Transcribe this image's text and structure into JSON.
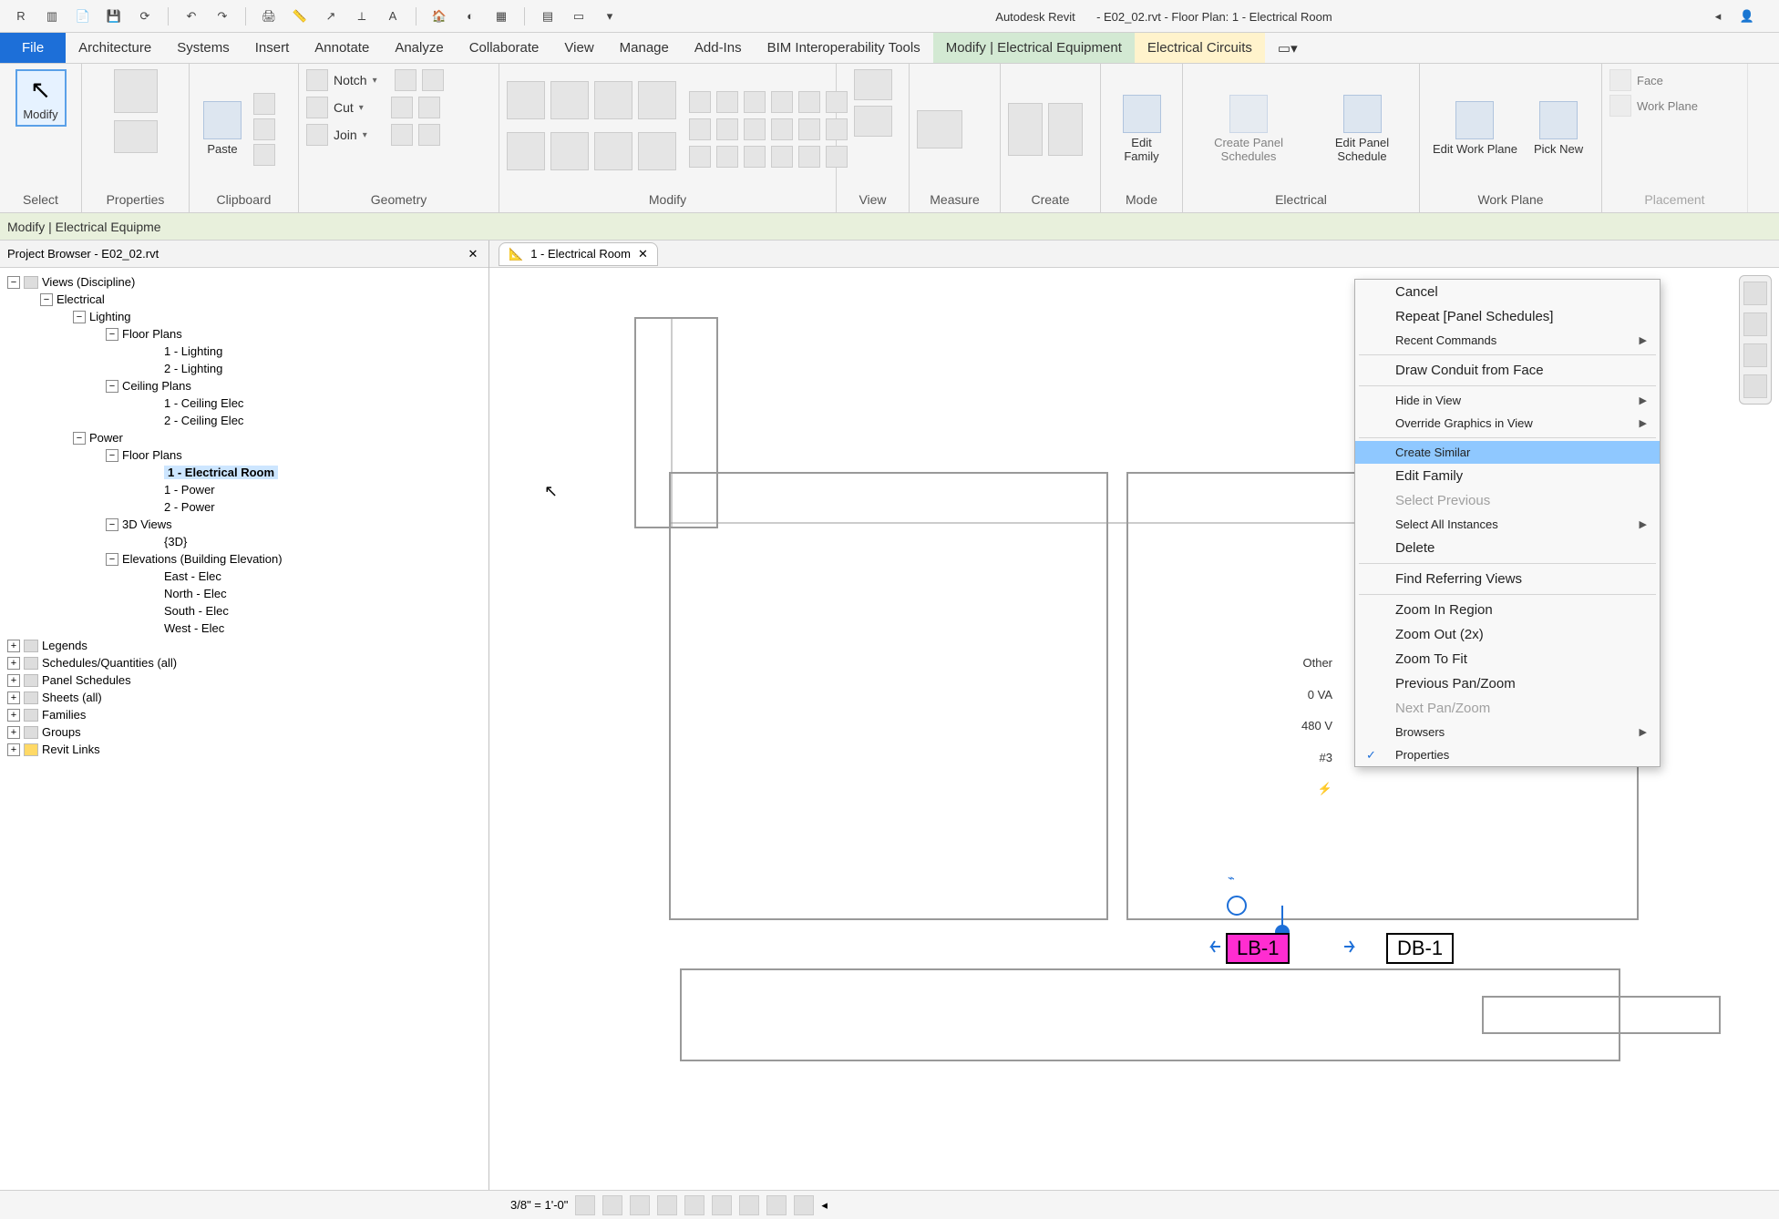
{
  "title": {
    "app": "Autodesk Revit",
    "doc": "- E02_02.rvt - Floor Plan: 1 - Electrical Room"
  },
  "menu": {
    "file": "File",
    "tabs": [
      "Architecture",
      "Systems",
      "Insert",
      "Annotate",
      "Analyze",
      "Collaborate",
      "View",
      "Manage",
      "Add-Ins",
      "BIM Interoperability Tools"
    ],
    "active": "Modify | Electrical Equipment",
    "second": "Electrical Circuits"
  },
  "ribbon": {
    "modify_label": "Modify",
    "select_group": "Select",
    "properties": "Properties",
    "clipboard": "Clipboard",
    "paste": "Paste",
    "geometry": "Geometry",
    "notch": "Notch",
    "cut": "Cut",
    "join": "Join",
    "modify": "Modify",
    "view": "View",
    "measure": "Measure",
    "create": "Create",
    "mode": "Mode",
    "edit_family": "Edit Family",
    "electrical": "Electrical",
    "create_ps": "Create Panel Schedules",
    "edit_ps": "Edit Panel Schedule",
    "work_plane_group": "Work Plane",
    "edit_wp": "Edit Work Plane",
    "pick_new": "Pick New",
    "placement": "Placement",
    "face": "Face",
    "wp": "Work Plane"
  },
  "context_bar": "Modify | Electrical Equipme",
  "project_browser": {
    "title": "Project Browser - E02_02.rvt",
    "views_root": "Views (Discipline)",
    "nodes": {
      "electrical": "Electrical",
      "lighting": "Lighting",
      "floor_plans": "Floor Plans",
      "lighting_1": "1 - Lighting",
      "lighting_2": "2 - Lighting",
      "ceiling_plans": "Ceiling Plans",
      "ceiling_1": "1 - Ceiling Elec",
      "ceiling_2": "2 - Ceiling Elec",
      "power": "Power",
      "power_fp": "Floor Plans",
      "elec_room": "1 - Electrical Room",
      "power_1": "1 - Power",
      "power_2": "2 - Power",
      "views_3d": "3D Views",
      "view_3d": "{3D}",
      "elevations": "Elevations (Building Elevation)",
      "east": "East - Elec",
      "north": "North - Elec",
      "south": "South - Elec",
      "west": "West - Elec"
    },
    "bottom": {
      "legends": "Legends",
      "schedules": "Schedules/Quantities (all)",
      "panel_schedules": "Panel Schedules",
      "sheets": "Sheets (all)",
      "families": "Families",
      "groups": "Groups",
      "revit_links": "Revit Links"
    }
  },
  "doc_tab": {
    "icon": "📐",
    "name": "1 - Electrical Room"
  },
  "canvas_data": {
    "other": "Other",
    "va": "0 VA",
    "volt": "480 V",
    "num": "#3",
    "panel_sel": "LB-1",
    "panel_db": "DB-1"
  },
  "context_menu": {
    "cancel": "Cancel",
    "repeat": "Repeat [Panel Schedules]",
    "recent": "Recent Commands",
    "draw_conduit": "Draw Conduit from Face",
    "hide": "Hide in View",
    "override": "Override Graphics in View",
    "create_similar": "Create Similar",
    "edit_family": "Edit Family",
    "select_prev": "Select Previous",
    "select_all": "Select All Instances",
    "delete": "Delete",
    "find_ref": "Find Referring Views",
    "zoom_in": "Zoom In Region",
    "zoom_out": "Zoom Out (2x)",
    "zoom_fit": "Zoom To Fit",
    "prev_pan": "Previous Pan/Zoom",
    "next_pan": "Next Pan/Zoom",
    "browsers": "Browsers",
    "properties": "Properties"
  },
  "statusbar": {
    "scale": "3/8\" = 1'-0\""
  }
}
